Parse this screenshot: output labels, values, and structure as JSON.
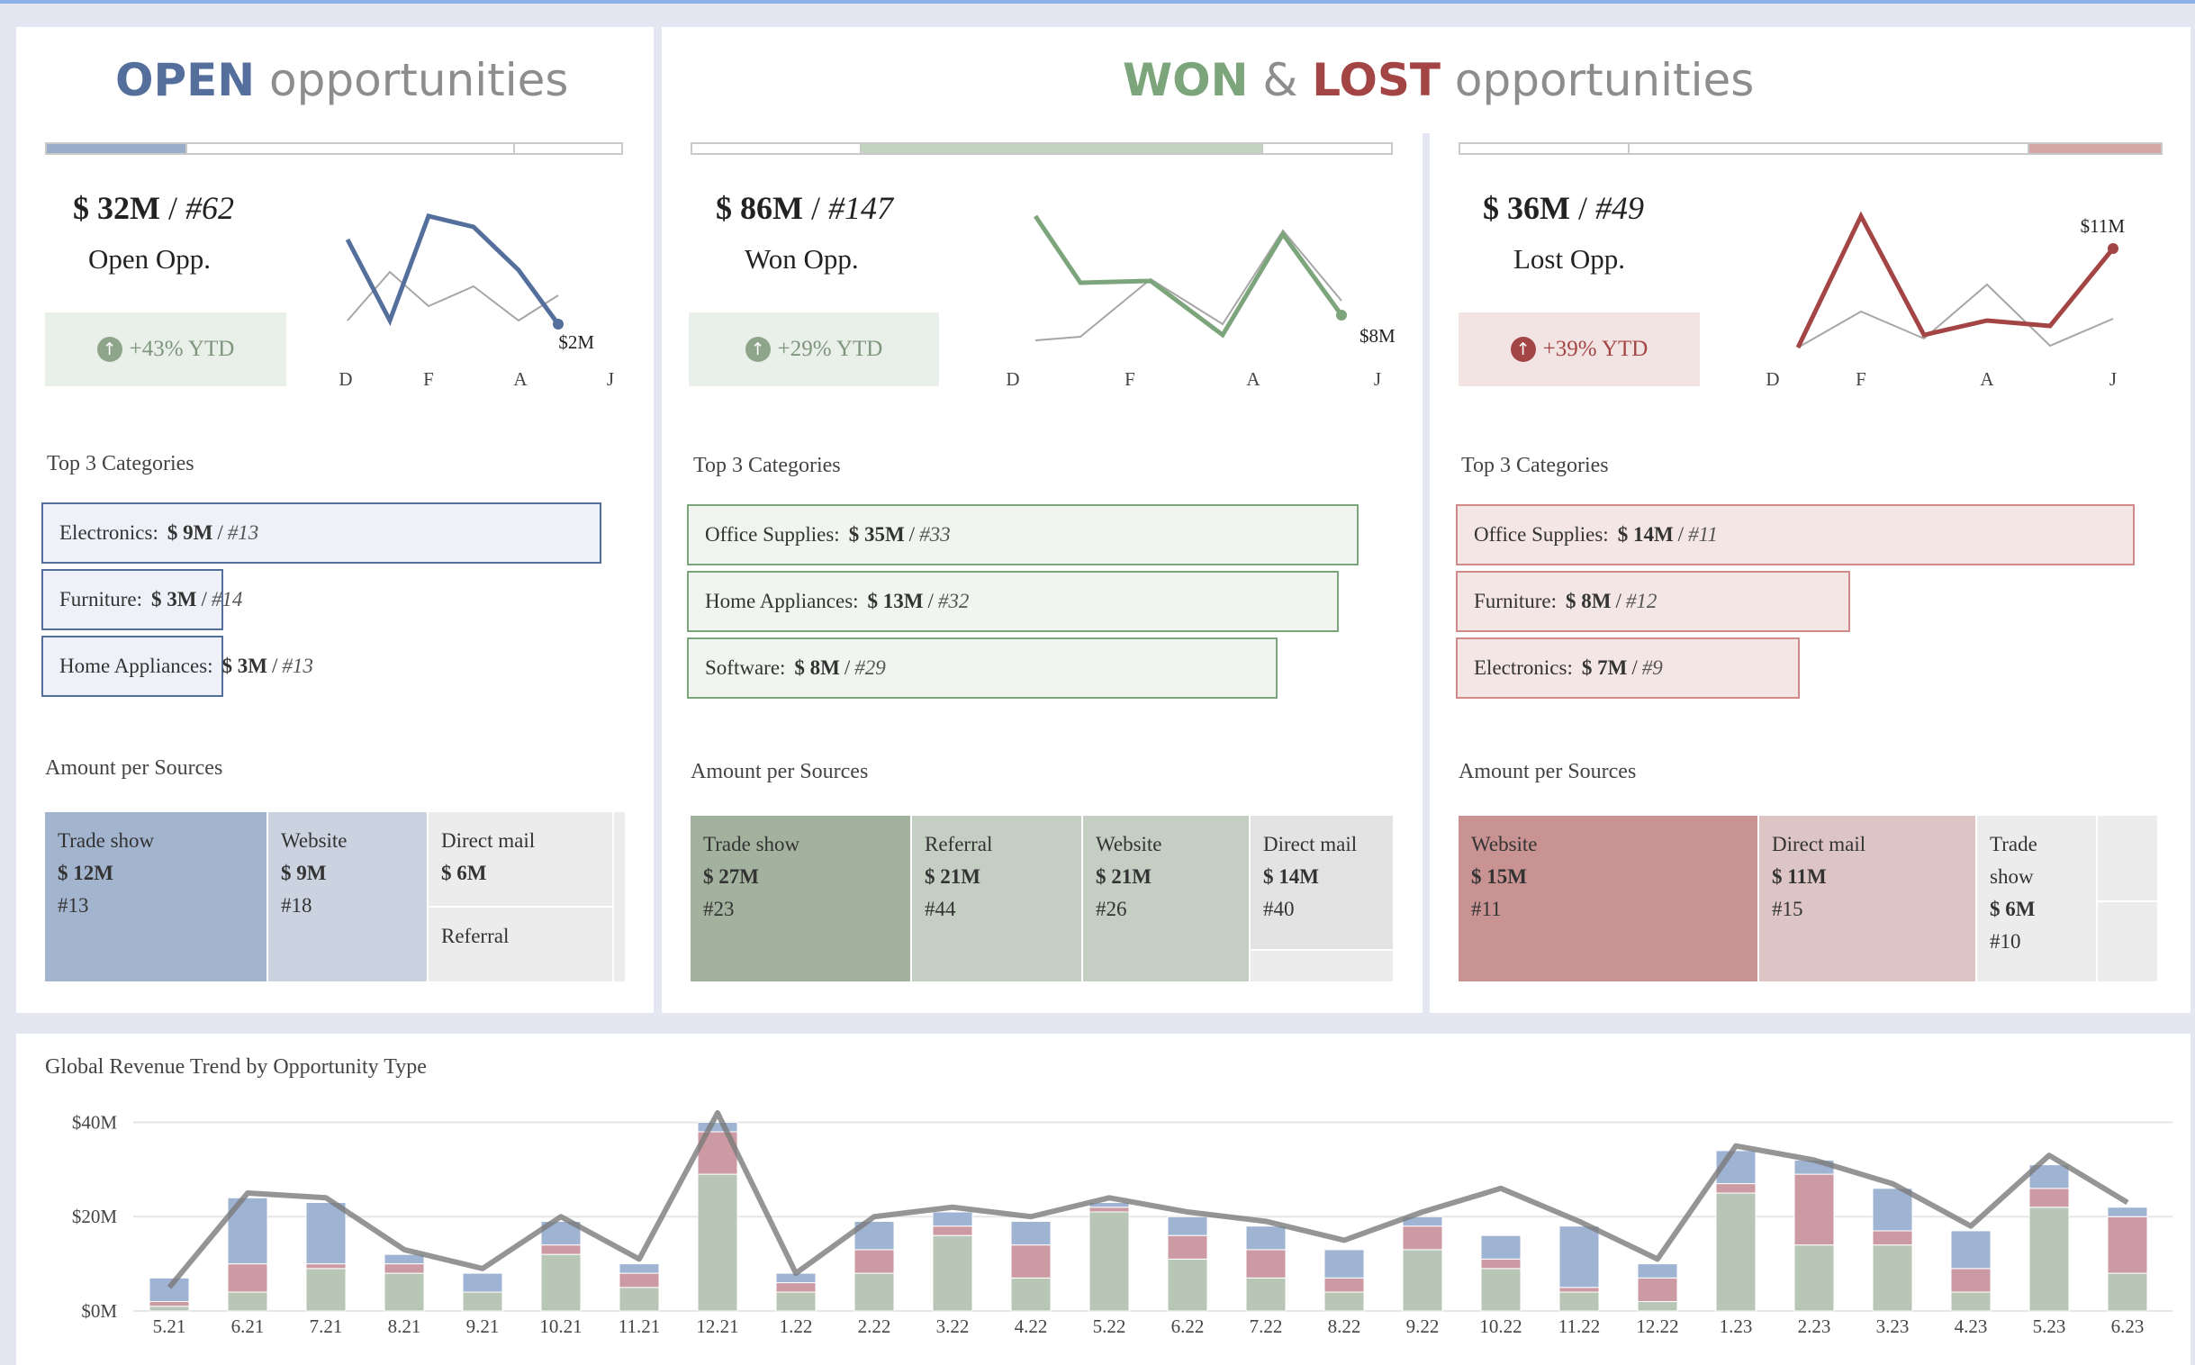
{
  "colors": {
    "open": "#546f9c",
    "won": "#7da57b",
    "lost": "#a44545",
    "grey": "#8d8d8d"
  },
  "open": {
    "title_bold": "OPEN",
    "title_rest": " opportunities",
    "kpi_amount": "$ 32M",
    "kpi_sep": " / ",
    "kpi_count": "#62",
    "kpi_label": "Open Opp.",
    "ytd": "+43% YTD",
    "ytd_icon": "arrow-up-circle-icon",
    "spark": {
      "months": [
        "D",
        "F",
        "A",
        "J"
      ],
      "end_label": "$2M"
    },
    "top3_title": "Top 3 Categories",
    "top3": [
      {
        "name": "Electronics:",
        "amount": "$ 9M",
        "count": "#13"
      },
      {
        "name": "Furniture:",
        "amount": "$ 3M",
        "count": "#14"
      },
      {
        "name": "Home Appliances:",
        "amount": "$ 3M",
        "count": "#13"
      }
    ],
    "sources_title": "Amount per Sources",
    "sources": [
      {
        "name": "Trade show",
        "amount": "$ 12M",
        "count": "#13"
      },
      {
        "name": "Website",
        "amount": "$ 9M",
        "count": "#18"
      },
      {
        "name": "Direct mail",
        "amount": "$ 6M",
        "count": ""
      },
      {
        "name": "Referral",
        "amount": "",
        "count": ""
      }
    ]
  },
  "wonlost_title": {
    "won": "WON",
    "amp": " & ",
    "lost": "LOST",
    "rest": " opportunities"
  },
  "won": {
    "kpi_amount": "$ 86M",
    "kpi_sep": " / ",
    "kpi_count": "#147",
    "kpi_label": "Won Opp.",
    "ytd": "+29% YTD",
    "ytd_icon": "arrow-up-circle-icon",
    "spark": {
      "months": [
        "D",
        "F",
        "A",
        "J"
      ],
      "end_label": "$8M"
    },
    "top3_title": "Top 3 Categories",
    "top3": [
      {
        "name": "Office Supplies:",
        "amount": "$ 35M",
        "count": "#33"
      },
      {
        "name": "Home Appliances:",
        "amount": "$ 13M",
        "count": "#32"
      },
      {
        "name": "Software:",
        "amount": "$ 8M",
        "count": "#29"
      }
    ],
    "sources_title": "Amount per Sources",
    "sources": [
      {
        "name": "Trade show",
        "amount": "$ 27M",
        "count": "#23"
      },
      {
        "name": "Referral",
        "amount": "$ 21M",
        "count": "#44"
      },
      {
        "name": "Website",
        "amount": "$ 21M",
        "count": "#26"
      },
      {
        "name": "Direct mail",
        "amount": "$ 14M",
        "count": "#40"
      }
    ]
  },
  "lost": {
    "kpi_amount": "$ 36M",
    "kpi_sep": " / ",
    "kpi_count": "#49",
    "kpi_label": "Lost Opp.",
    "ytd": "+39% YTD",
    "ytd_icon": "arrow-up-circle-icon",
    "spark": {
      "months": [
        "D",
        "F",
        "A",
        "J"
      ],
      "end_label": "$11M"
    },
    "top3_title": "Top 3 Categories",
    "top3": [
      {
        "name": "Office Supplies:",
        "amount": "$ 14M",
        "count": "#11"
      },
      {
        "name": "Furniture:",
        "amount": "$ 8M",
        "count": "#12"
      },
      {
        "name": "Electronics:",
        "amount": "$ 7M",
        "count": "#9"
      }
    ],
    "sources_title": "Amount per Sources",
    "sources": [
      {
        "name": "Website",
        "amount": "$ 15M",
        "count": "#11"
      },
      {
        "name": "Direct mail",
        "amount": "$ 11M",
        "count": "#15"
      },
      {
        "name": "Trade show",
        "amount": "$ 6M",
        "count": "#10"
      }
    ]
  },
  "trend_title": "Global Revenue Trend by Opportunity Type",
  "chart_data": {
    "type": "bar",
    "title": "Global Revenue Trend by Opportunity Type",
    "categories": [
      "5.21",
      "6.21",
      "7.21",
      "8.21",
      "9.21",
      "10.21",
      "11.21",
      "12.21",
      "1.22",
      "2.22",
      "3.22",
      "4.22",
      "5.22",
      "6.22",
      "7.22",
      "8.22",
      "9.22",
      "10.22",
      "11.22",
      "12.22",
      "1.23",
      "2.23",
      "3.23",
      "4.23",
      "5.23",
      "6.23"
    ],
    "yticks": [
      "$0M",
      "$20M",
      "$40M"
    ],
    "ylim": [
      0,
      42
    ],
    "stacked": true,
    "series": [
      {
        "color": "#b8c6b5",
        "values": [
          1,
          4,
          9,
          8,
          4,
          12,
          5,
          29,
          4,
          8,
          16,
          7,
          21,
          11,
          7,
          4,
          13,
          9,
          4,
          2,
          25,
          14,
          14,
          4,
          22,
          8
        ]
      },
      {
        "color": "#cc9aa3",
        "values": [
          1,
          6,
          1,
          2,
          0,
          2,
          3,
          9,
          2,
          5,
          2,
          7,
          1,
          5,
          6,
          3,
          5,
          2,
          1,
          5,
          2,
          15,
          3,
          5,
          4,
          12
        ]
      },
      {
        "color": "#9fb3d3",
        "values": [
          5,
          14,
          13,
          2,
          4,
          5,
          2,
          2,
          2,
          6,
          3,
          5,
          1,
          4,
          5,
          6,
          2,
          5,
          13,
          3,
          7,
          3,
          9,
          8,
          5,
          2
        ]
      }
    ],
    "total_line": [
      5,
      25,
      24,
      13,
      9,
      20,
      11,
      42,
      8,
      20,
      22,
      20,
      24,
      21,
      19,
      15,
      21,
      26,
      19,
      11,
      35,
      32,
      27,
      18,
      33,
      23
    ]
  }
}
